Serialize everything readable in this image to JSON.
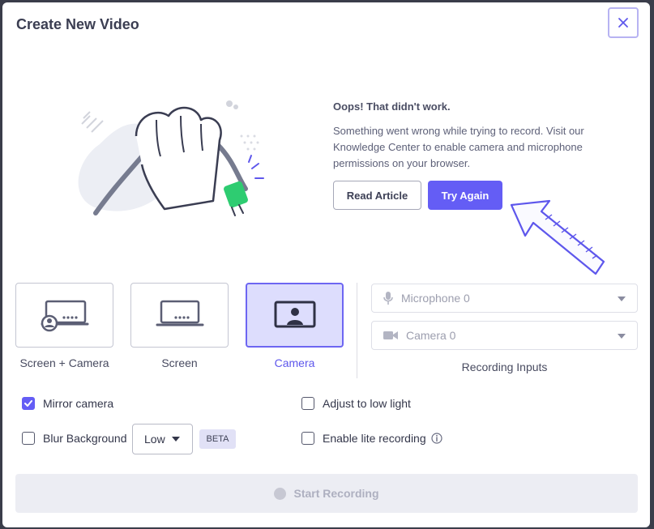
{
  "dialog": {
    "title": "Create New Video",
    "close_icon": "close-icon"
  },
  "error": {
    "title": "Oops! That didn't work.",
    "message": "Something went wrong while trying to record. Visit our Knowledge Center to enable camera and microphone permissions on your browser.",
    "read_article_label": "Read Article",
    "try_again_label": "Try Again",
    "illustration": "unplugged-cable-hand-illustration",
    "arrow_icon": "hand-drawn-arrow-icon"
  },
  "modes": [
    {
      "label": "Screen + Camera",
      "icon": "screen-camera-icon",
      "selected": false
    },
    {
      "label": "Screen",
      "icon": "screen-icon",
      "selected": false
    },
    {
      "label": "Camera",
      "icon": "camera-user-icon",
      "selected": true
    }
  ],
  "inputs": {
    "microphone": {
      "label": "Microphone 0",
      "icon": "microphone-icon"
    },
    "camera": {
      "label": "Camera 0",
      "icon": "video-camera-icon"
    },
    "section_label": "Recording Inputs"
  },
  "options": {
    "mirror_camera": {
      "label": "Mirror camera",
      "checked": true
    },
    "adjust_low_light": {
      "label": "Adjust to low light",
      "checked": false
    },
    "blur_background": {
      "label": "Blur Background",
      "checked": false,
      "level": "Low",
      "badge": "BETA"
    },
    "lite_recording": {
      "label": "Enable lite recording",
      "checked": false,
      "info_icon": "info-icon"
    }
  },
  "start_button": {
    "label": "Start Recording"
  },
  "colors": {
    "accent": "#645df5",
    "accent_light": "#ddddfd",
    "plug_green": "#2ecc71",
    "disabled_bg": "#ecedf3"
  }
}
